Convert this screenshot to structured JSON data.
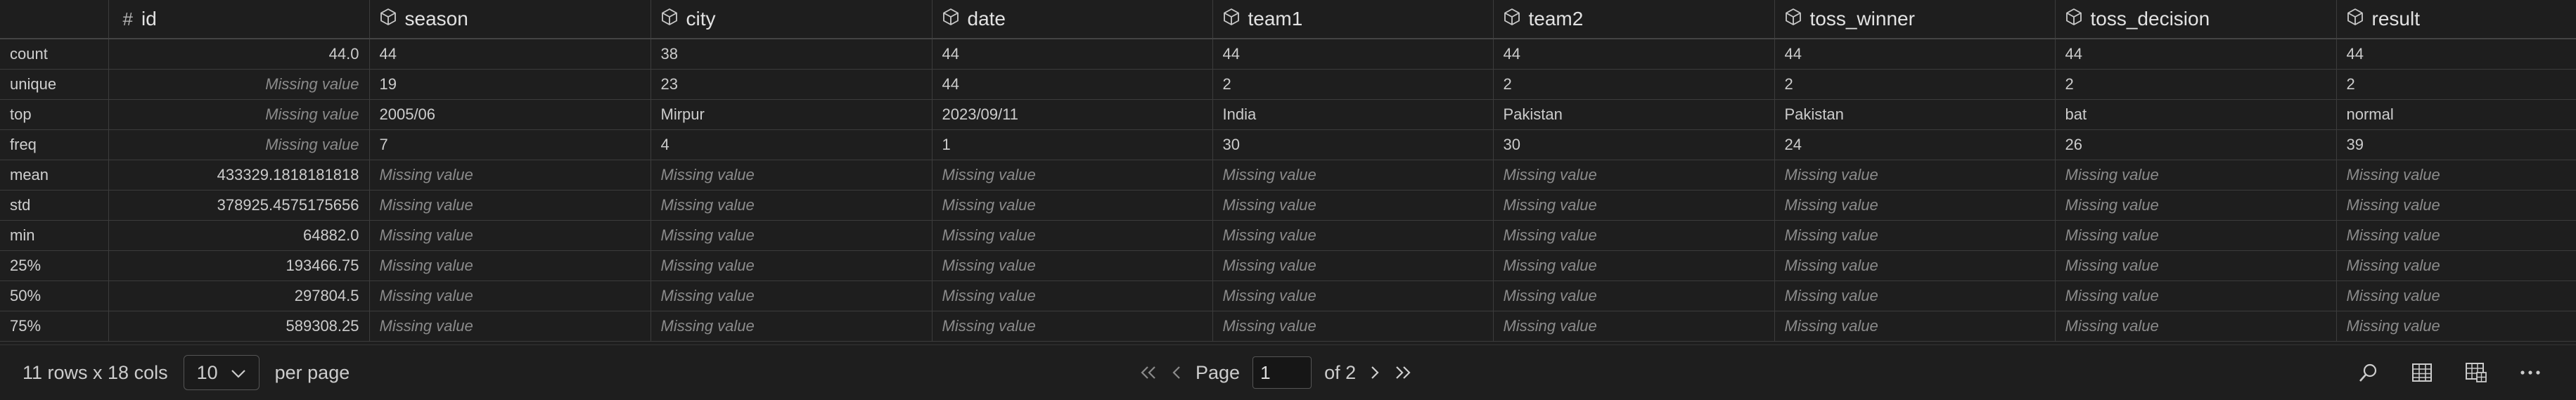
{
  "columns": [
    {
      "key": "id",
      "label": "id",
      "icon": "hash-icon"
    },
    {
      "key": "season",
      "label": "season",
      "icon": "cube-icon"
    },
    {
      "key": "city",
      "label": "city",
      "icon": "cube-icon"
    },
    {
      "key": "date",
      "label": "date",
      "icon": "cube-icon"
    },
    {
      "key": "team1",
      "label": "team1",
      "icon": "cube-icon"
    },
    {
      "key": "team2",
      "label": "team2",
      "icon": "cube-icon"
    },
    {
      "key": "toss_winner",
      "label": "toss_winner",
      "icon": "cube-icon"
    },
    {
      "key": "toss_decision",
      "label": "toss_decision",
      "icon": "cube-icon"
    },
    {
      "key": "result",
      "label": "result",
      "icon": "cube-icon"
    }
  ],
  "missing_label": "Missing value",
  "rows": [
    {
      "index": "count",
      "cells": [
        "44.0",
        "44",
        "38",
        "44",
        "44",
        "44",
        "44",
        "44",
        "44"
      ]
    },
    {
      "index": "unique",
      "cells": [
        null,
        "19",
        "23",
        "44",
        "2",
        "2",
        "2",
        "2",
        "2"
      ]
    },
    {
      "index": "top",
      "cells": [
        null,
        "2005/06",
        "Mirpur",
        "2023/09/11",
        "India",
        "Pakistan",
        "Pakistan",
        "bat",
        "normal"
      ]
    },
    {
      "index": "freq",
      "cells": [
        null,
        "7",
        "4",
        "1",
        "30",
        "30",
        "24",
        "26",
        "39"
      ]
    },
    {
      "index": "mean",
      "cells": [
        "433329.1818181818",
        null,
        null,
        null,
        null,
        null,
        null,
        null,
        null
      ]
    },
    {
      "index": "std",
      "cells": [
        "378925.4575175656",
        null,
        null,
        null,
        null,
        null,
        null,
        null,
        null
      ]
    },
    {
      "index": "min",
      "cells": [
        "64882.0",
        null,
        null,
        null,
        null,
        null,
        null,
        null,
        null
      ]
    },
    {
      "index": "25%",
      "cells": [
        "193466.75",
        null,
        null,
        null,
        null,
        null,
        null,
        null,
        null
      ]
    },
    {
      "index": "50%",
      "cells": [
        "297804.5",
        null,
        null,
        null,
        null,
        null,
        null,
        null,
        null
      ]
    },
    {
      "index": "75%",
      "cells": [
        "589308.25",
        null,
        null,
        null,
        null,
        null,
        null,
        null,
        null
      ]
    }
  ],
  "footer": {
    "summary": "11 rows x 18 cols",
    "per_page_value": "10",
    "per_page_label": "per page",
    "page_label": "Page",
    "current_page": "1",
    "of_pages": "of 2"
  },
  "icons": {
    "first": "double-chevron-left-icon",
    "prev": "chevron-left-icon",
    "next": "chevron-right-icon",
    "last": "double-chevron-right-icon",
    "search": "search-icon",
    "table": "table-icon",
    "grid": "grid-view-icon",
    "more": "more-icon"
  },
  "colors": {
    "background": "#1e1e1e",
    "border": "#3c3c3c",
    "text": "#cccccc",
    "missing": "#8b8b8b"
  }
}
